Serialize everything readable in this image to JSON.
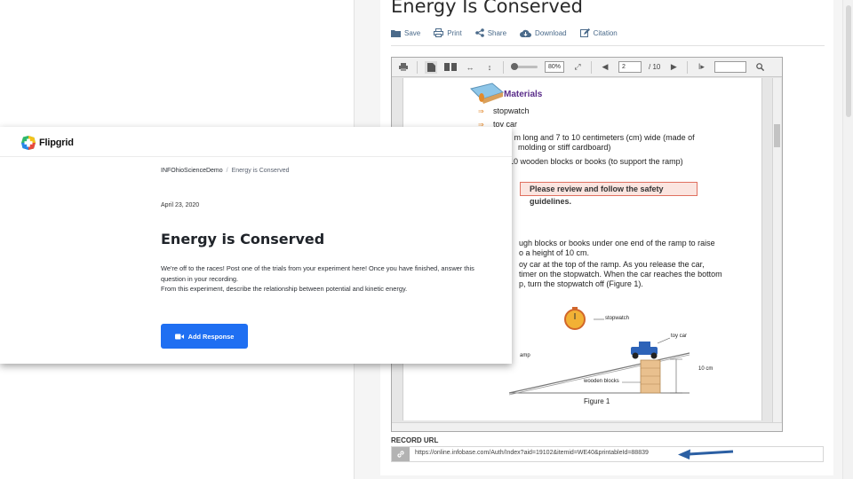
{
  "document": {
    "title": "Energy Is Conserved",
    "actions": [
      {
        "label": "Save",
        "icon": "folder-icon"
      },
      {
        "label": "Print",
        "icon": "printer-icon"
      },
      {
        "label": "Share",
        "icon": "share-icon"
      },
      {
        "label": "Download",
        "icon": "cloud-download-icon"
      },
      {
        "label": "Citation",
        "icon": "pencil-icon"
      }
    ],
    "viewer": {
      "zoom": "80%",
      "page_current": "2",
      "page_total": "/ 10",
      "search_placeholder": ""
    },
    "sheet": {
      "materials_heading": "Materials",
      "material_items": [
        "stopwatch",
        "toy car",
        "1 m long and 7 to 10 centimeters (cm) wide (made of",
        "molding or stiff cardboard)",
        "10 wooden blocks or books (to support the ramp)"
      ],
      "safety_note": "Please review and follow the safety guidelines.",
      "procedure_lines": [
        "ugh blocks or books under one end of the ramp to raise",
        "o a height of 10 cm.",
        "oy car at the top of the ramp. As you release the car,",
        "timer on the stopwatch. When the car reaches the bottom",
        "p, turn the stopwatch off (Figure 1)."
      ],
      "figure_labels": {
        "stopwatch": "stopwatch",
        "toy_car": "toy car",
        "ramp": "amp",
        "wooden_blocks": "wooden blocks",
        "height": "10 cm"
      },
      "figure_caption": "Figure 1"
    },
    "record": {
      "label": "RECORD URL",
      "url": "https://online.infobase.com/Auth/Index?aid=19102&itemid=WE40&printableId=88839"
    },
    "accent_color": "#4a6a8a",
    "arrow_color": "#2b5fa3"
  },
  "flipgrid": {
    "brand": "Flipgrid",
    "breadcrumb": {
      "group": "INFOhioScienceDemo",
      "separator": "/",
      "topic": "Energy is Conserved"
    },
    "date": "April 23, 2020",
    "title": "Energy is Conserved",
    "prompt_line1": "We're off to the races! Post one of the trials from your experiment here! Once you have finished, answer this question in your recording.",
    "prompt_line2": "From this experiment, describe the relationship between potential and kinetic energy.",
    "add_response_label": "Add Response",
    "button_color": "#1f6ff2"
  }
}
